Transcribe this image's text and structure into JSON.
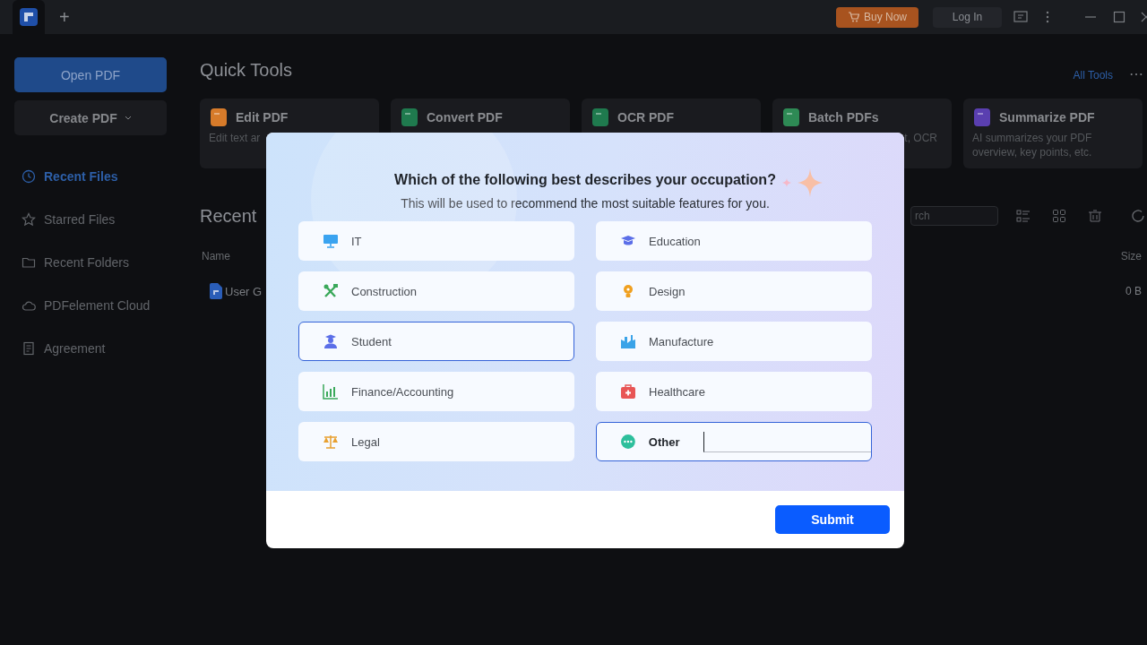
{
  "titlebar": {
    "new_tab": "+",
    "buy_button": "Buy Now",
    "login_button": "Log In"
  },
  "sidebar": {
    "open_button": "Open PDF",
    "create_button": "Create PDF",
    "items": [
      {
        "label": "Recent Files",
        "selected": true
      },
      {
        "label": "Starred Files",
        "selected": false
      },
      {
        "label": "Recent Folders",
        "selected": false
      },
      {
        "label": "PDFelement Cloud",
        "selected": false
      },
      {
        "label": "Agreement",
        "selected": false
      }
    ]
  },
  "quick_tools": {
    "title": "Quick Tools",
    "all_tools": "All Tools",
    "more": "⋯",
    "cards": [
      {
        "title": "Edit PDF",
        "description": "Edit text ar"
      },
      {
        "title": "Convert PDF"
      },
      {
        "title": "OCR PDF"
      },
      {
        "title": "Batch PDFs",
        "description": "t, OCR"
      },
      {
        "title": "Summarize PDF",
        "description": "AI summarizes your PDF overview, key points, etc."
      }
    ]
  },
  "recent": {
    "title": "Recent",
    "search": {
      "placeholder": "rch"
    },
    "columns": [
      "Name",
      "Size"
    ],
    "rows": [
      {
        "name": "User G",
        "size": "0 B"
      }
    ]
  },
  "dialog": {
    "title": "Which of the following best describes your occupation?",
    "subtitle": "This will be used to recommend the most suitable features for you.",
    "options": [
      {
        "kind": "option",
        "label": "IT",
        "selected": false
      },
      {
        "kind": "option",
        "label": "Education",
        "selected": false
      },
      {
        "kind": "option",
        "label": "Construction",
        "selected": false
      },
      {
        "kind": "option",
        "label": "Design",
        "selected": false
      },
      {
        "kind": "option",
        "label": "Student",
        "selected": true
      },
      {
        "kind": "option",
        "label": "Manufacture",
        "selected": false
      },
      {
        "kind": "option",
        "label": "Finance/Accounting",
        "selected": false
      },
      {
        "kind": "option",
        "label": "Healthcare",
        "selected": false
      },
      {
        "kind": "option",
        "label": "Legal",
        "selected": false
      },
      {
        "kind": "input",
        "label": "Other",
        "selected": true
      }
    ],
    "submit_button": "Submit"
  }
}
